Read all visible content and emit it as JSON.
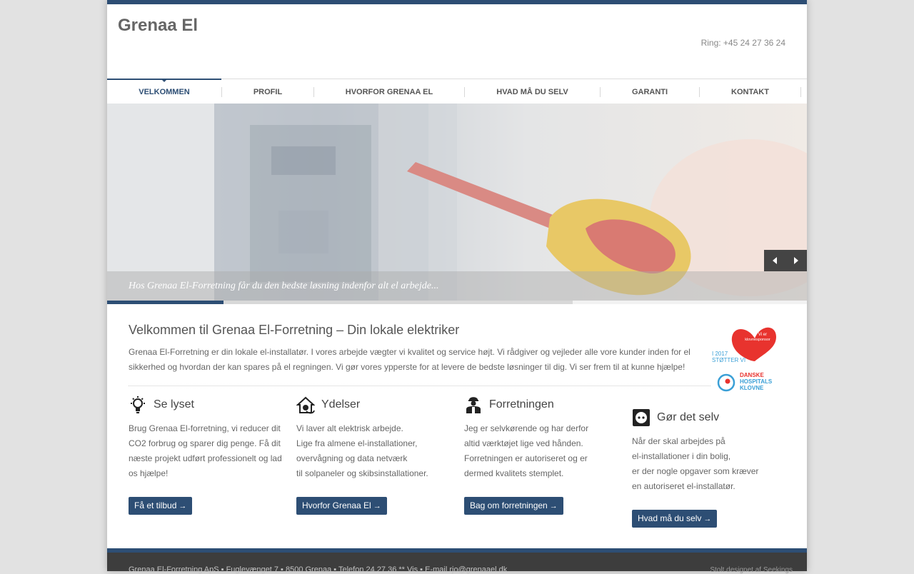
{
  "header": {
    "logo": "Grenaa El",
    "phone": "Ring: +45 24 27 36 24"
  },
  "nav": {
    "items": [
      {
        "label": "VELKOMMEN",
        "active": true
      },
      {
        "label": "PROFIL",
        "active": false
      },
      {
        "label": "HVORFOR GRENAA EL",
        "active": false
      },
      {
        "label": "HVAD MÅ DU SELV",
        "active": false
      },
      {
        "label": "GARANTI",
        "active": false
      },
      {
        "label": "KONTAKT",
        "active": false
      }
    ]
  },
  "slider": {
    "caption": "Hos Grenaa El-Forretning får du den bedste løsning indenfor alt el arbejde...",
    "progress": 0.166,
    "prev_icon": "arrow-left-icon",
    "next_icon": "arrow-right-icon"
  },
  "welcome": {
    "title": "Velkommen til Grenaa El-Forretning – Din lokale elektriker",
    "intro_lines": [
      "Grenaa El-Forretning er din lokale el-installatør. I vores arbejde vægter vi kvalitet og service højt. Vi rådgiver og vejleder alle vore kunder inden for el",
      "sikkerhed og hvordan der kan spares på el regningen. Vi gør vores ypperste for at levere de bedste løsninger til dig. Vi ser frem til at kunne hjælpe!"
    ]
  },
  "badge": {
    "heart_text_1": "Vi er",
    "heart_text_2": "klovnesponsor",
    "year_text": "I 2017",
    "support_text": "STØTTER VI",
    "org_line_1": "DANSKE",
    "org_line_2": "HOSPITALS",
    "org_line_3": "KLOVNE"
  },
  "columns": [
    {
      "icon": "lightbulb-icon",
      "title": "Se lyset",
      "lines": [
        "Brug Grenaa El-forretning, vi reducer dit",
        "CO2 forbrug og sparer dig penge. Få dit",
        "næste projekt udført professionelt og lad",
        "os hjælpe!"
      ],
      "button": "Få et tilbud",
      "arrow": "→"
    },
    {
      "icon": "house-plug-icon",
      "title": "Ydelser",
      "lines": [
        "Vi laver alt elektrisk arbejde.",
        "Lige fra  almene el-installationer,",
        "overvågning og data netværk",
        "til solpaneler og skibsinstallationer."
      ],
      "button": "Hvorfor Grenaa El",
      "arrow": "→"
    },
    {
      "icon": "electrician-icon",
      "title": "Forretningen",
      "lines": [
        "Jeg er selvkørende og har derfor",
        "altid værktøjet lige ved hånden.",
        "Forretningen er autoriseret og er",
        "dermed kvalitets stemplet."
      ],
      "button": "Bag om forretningen",
      "arrow": "→"
    },
    {
      "icon": "power-outlet-icon",
      "title": "Gør det selv",
      "lines": [
        "Når der skal arbejdes på",
        "el-installationer i din bolig,",
        "er der nogle opgaver som kræver",
        "en autoriseret el-installatør."
      ],
      "button": "Hvad må du selv",
      "arrow": "→"
    }
  ],
  "footer": {
    "text": "Grenaa El-Forretning ApS  ▪  Fuglevænget 7  ▪  8500 Grenaa  ▪  Telefon 24 27 36 ** Vis ▪  E-mail rjo@grenaael.dk",
    "credit": "Stolt designet af Seekings"
  },
  "colors": {
    "brand": "#2d4e74",
    "footer_bg": "#3d3d3d",
    "heart": "#e8332e"
  }
}
